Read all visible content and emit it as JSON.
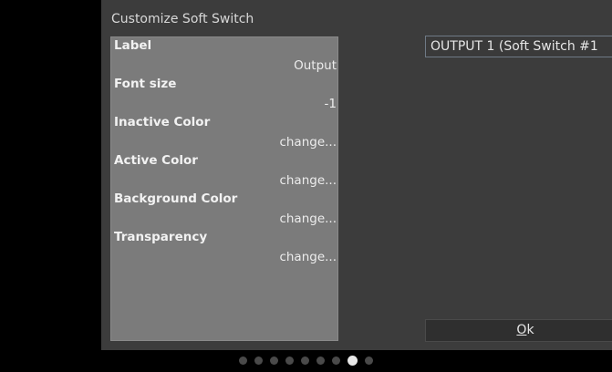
{
  "dialog": {
    "title": "Customize Soft Switch",
    "properties": [
      {
        "label": "Label",
        "value": "Output"
      },
      {
        "label": "Font size",
        "value": "-1"
      },
      {
        "label": "Inactive Color",
        "value": "change..."
      },
      {
        "label": "Active Color",
        "value": "change..."
      },
      {
        "label": "Background Color",
        "value": "change..."
      },
      {
        "label": "Transparency",
        "value": "change..."
      }
    ],
    "preview_text": "OUTPUT 1 (Soft Switch #1",
    "ok_label": {
      "accel": "O",
      "rest": "k"
    }
  },
  "pager": {
    "count": 9,
    "active_index": 7
  }
}
